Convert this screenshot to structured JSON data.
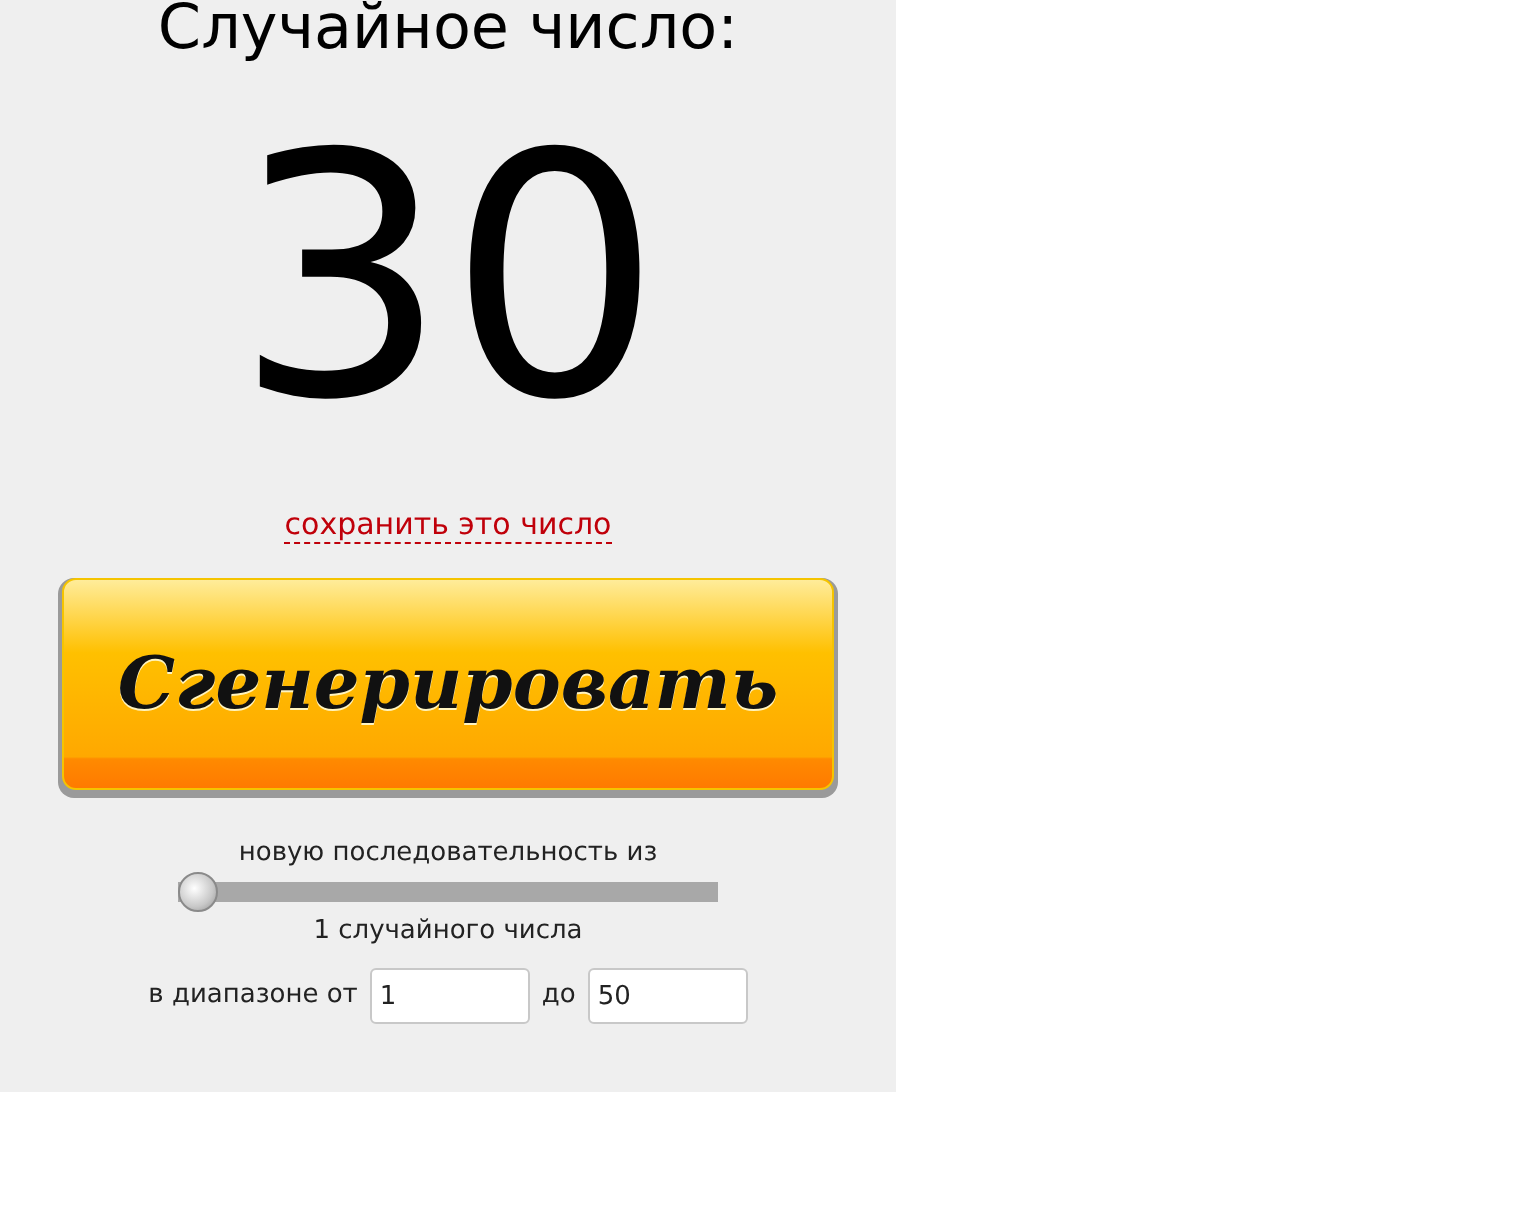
{
  "title": "Случайное число:",
  "result": "30",
  "save_link": "сохранить это число",
  "generate_button": "Сгенерировать",
  "sequence_label": "новую последовательность из",
  "count_slider": {
    "level": 0
  },
  "count_label": "1 случайного числа",
  "range": {
    "label_from": "в диапазоне от",
    "from": "1",
    "label_to": "до",
    "to": "50"
  }
}
